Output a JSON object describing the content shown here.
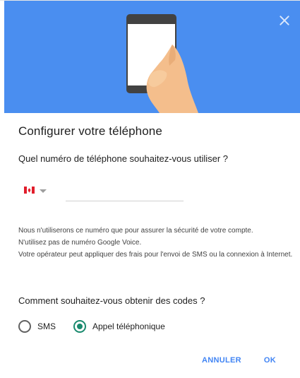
{
  "hero": {
    "background_color": "#4a8ef0",
    "illustration": "hand-holding-phone-illustration",
    "close_icon": "close-icon"
  },
  "dialog": {
    "title": "Configurer votre téléphone",
    "question": "Quel numéro de téléphone souhaitez-vous utiliser ?",
    "phone": {
      "country_flag": "canada-flag-icon",
      "dropdown_icon": "chevron-down-icon",
      "value": "",
      "placeholder": ""
    },
    "info_lines": [
      "Nous n'utiliserons ce numéro que pour assurer la sécurité de votre compte.",
      "N'utilisez pas de numéro Google Voice.",
      "Votre opérateur peut appliquer des frais pour l'envoi de SMS ou la connexion à Internet."
    ],
    "codes_question": "Comment souhaitez-vous obtenir des codes ?",
    "options": [
      {
        "label": "SMS",
        "selected": false
      },
      {
        "label": "Appel téléphonique",
        "selected": true
      }
    ],
    "actions": {
      "cancel_label": "ANNULER",
      "ok_label": "OK",
      "accent_color": "#4285f4"
    },
    "radio_accent_color": "#1a8a6e"
  }
}
